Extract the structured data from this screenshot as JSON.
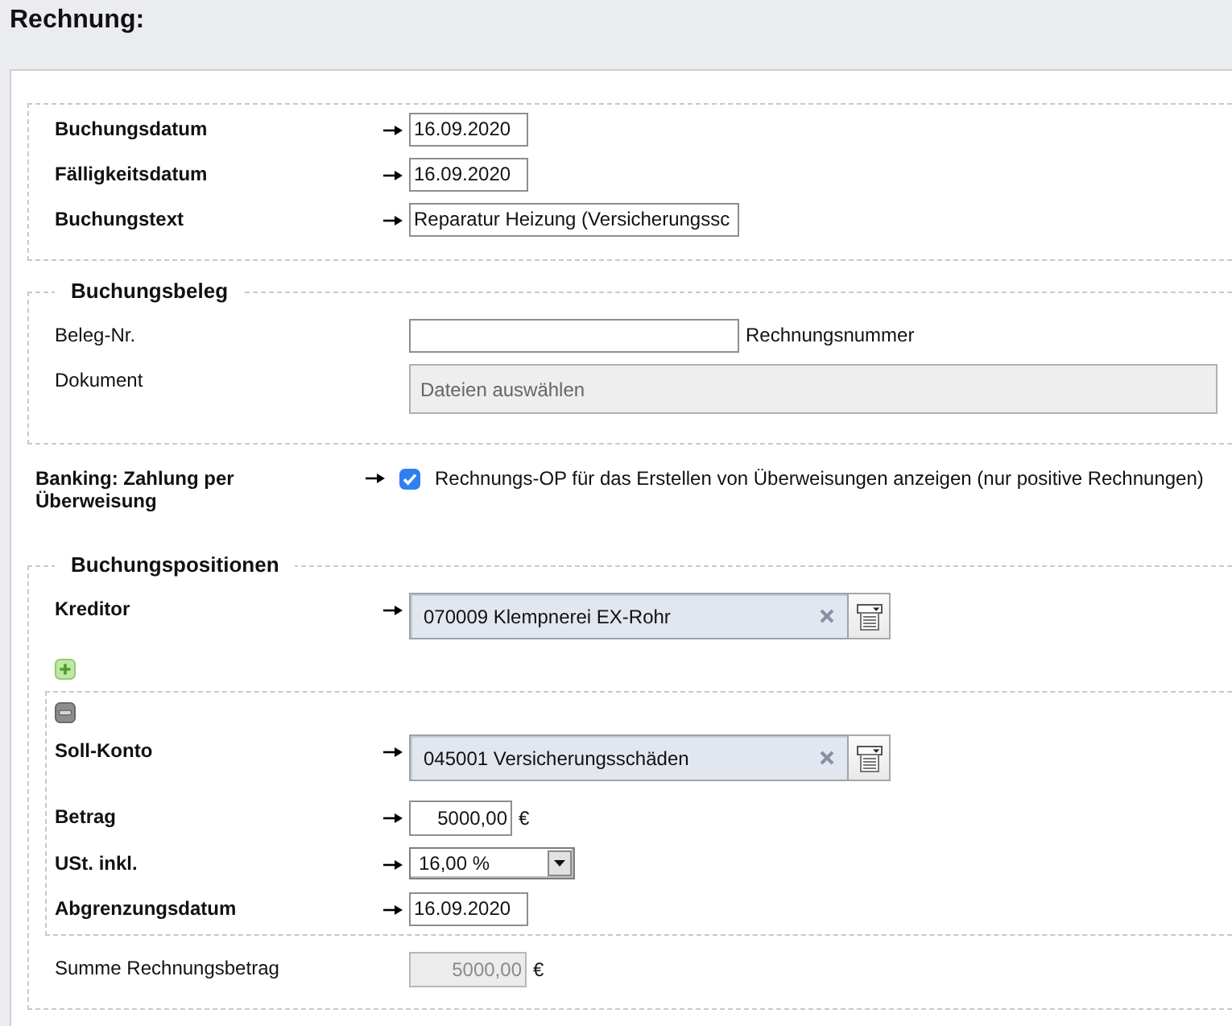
{
  "title": "Rechnung:",
  "general": {
    "fields": [
      {
        "kind": "date",
        "label": "Buchungsdatum",
        "required": true,
        "value": "16.09.2020",
        "disabled": false
      },
      {
        "kind": "date",
        "label": "Fälligkeitsdatum",
        "required": true,
        "value": "16.09.2020",
        "disabled": false
      },
      {
        "kind": "text",
        "label": "Buchungstext",
        "required": true,
        "value": "Reparatur Heizung (Versicherungssc",
        "disabled": false
      }
    ]
  },
  "document_section": {
    "legend": "Buchungsbeleg",
    "fields": [
      {
        "kind": "text",
        "label": "Beleg-Nr.",
        "required": false,
        "suffix": "Rechnungsnummer",
        "disabled": false
      },
      {
        "kind": "file",
        "label": "Dokument",
        "required": false,
        "placeholder": "Dateien auswählen",
        "disabled": false
      }
    ]
  },
  "banking": {
    "label": "Banking: Zahlung per Überweisung",
    "required": true,
    "option": {
      "label": "Rechnungs-OP für das Erstellen von Überweisungen anzeigen (nur positive Rechnungen)",
      "checked": true
    }
  },
  "positions_section": {
    "legend": "Buchungspositionen",
    "fields": [
      {
        "kind": "lookup",
        "label": "Kreditor",
        "required": true,
        "value": "070009 Klempnerei EX-Rohr",
        "disabled": false
      }
    ],
    "positions": [
      {
        "fields": [
          {
            "kind": "lookup",
            "label": "Soll-Konto",
            "required": true,
            "value": "045001 Versicherungsschäden",
            "disabled": false
          },
          {
            "kind": "amount",
            "label": "Betrag",
            "required": true,
            "value": "5000,00",
            "unit": "€",
            "disabled": false
          },
          {
            "kind": "select",
            "label": "USt. inkl.",
            "required": true,
            "value": "16,00 %",
            "disabled": false
          },
          {
            "kind": "date",
            "label": "Abgrenzungsdatum",
            "required": true,
            "value": "16.09.2020",
            "disabled": false
          }
        ]
      }
    ],
    "total": {
      "kind": "sum",
      "label": "Summe Rechnungsbetrag",
      "required": false,
      "value": "5000,00",
      "unit": "€",
      "disabled": true
    }
  }
}
